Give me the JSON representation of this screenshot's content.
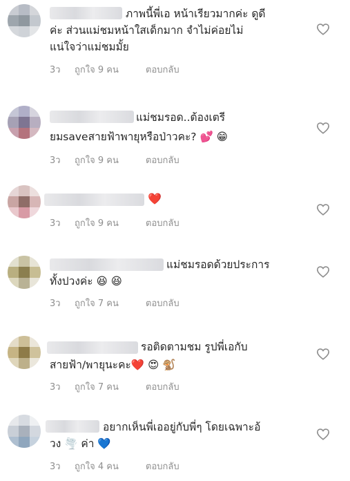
{
  "comments": [
    {
      "lines": [
        "ภาพนี้พี่เอ หน้าเรียวมากค่ะ ดูดี",
        "ค่ะ  ส่วนแม่ชมหน้าใสเด็กมาก จำไม่ค่อยไม่",
        "แน่ใจว่าแม่ชมมั้ย"
      ],
      "time": "3ว",
      "likes": "ถูกใจ 9 คน",
      "reply": "ตอบกลับ"
    },
    {
      "lines": [
        "แม่ชมรอด..ต้องเตรี",
        "ยมsaveสายฟ้าพายุหรือป่าวคะ? 💕 😁"
      ],
      "time": "3ว",
      "likes": "ถูกใจ 9 คน",
      "reply": "ตอบกลับ"
    },
    {
      "lines": [
        "❤️"
      ],
      "time": "3ว",
      "likes": "ถูกใจ 9 คน",
      "reply": "ตอบกลับ"
    },
    {
      "lines": [
        "แม่ชมรอดด้วยประการ",
        "ทั้งปวงค่ะ 😆 😆"
      ],
      "time": "3ว",
      "likes": "ถูกใจ 7 คน",
      "reply": "ตอบกลับ"
    },
    {
      "lines": [
        "รอติดตามชม รูปพี่เอกับ",
        "สายฟ้า/พายุนะคะ❤️ 😍 🐒"
      ],
      "time": "3ว",
      "likes": "ถูกใจ 7 คน",
      "reply": "ตอบกลับ"
    },
    {
      "lines": [
        "อยากเห็นพี่เออยู่กับพี่ๆ โดยเฉพาะอ้",
        "วง 🌪️ ค่า 💙"
      ],
      "time": "3ว",
      "likes": "ถูกใจ 4 คน",
      "reply": "ตอบกลับ"
    }
  ],
  "icons": {
    "like": "heart-outline-icon"
  },
  "colors": {
    "text": "#262626",
    "meta": "#8e8e8e",
    "heart": "#8e8e8e"
  }
}
